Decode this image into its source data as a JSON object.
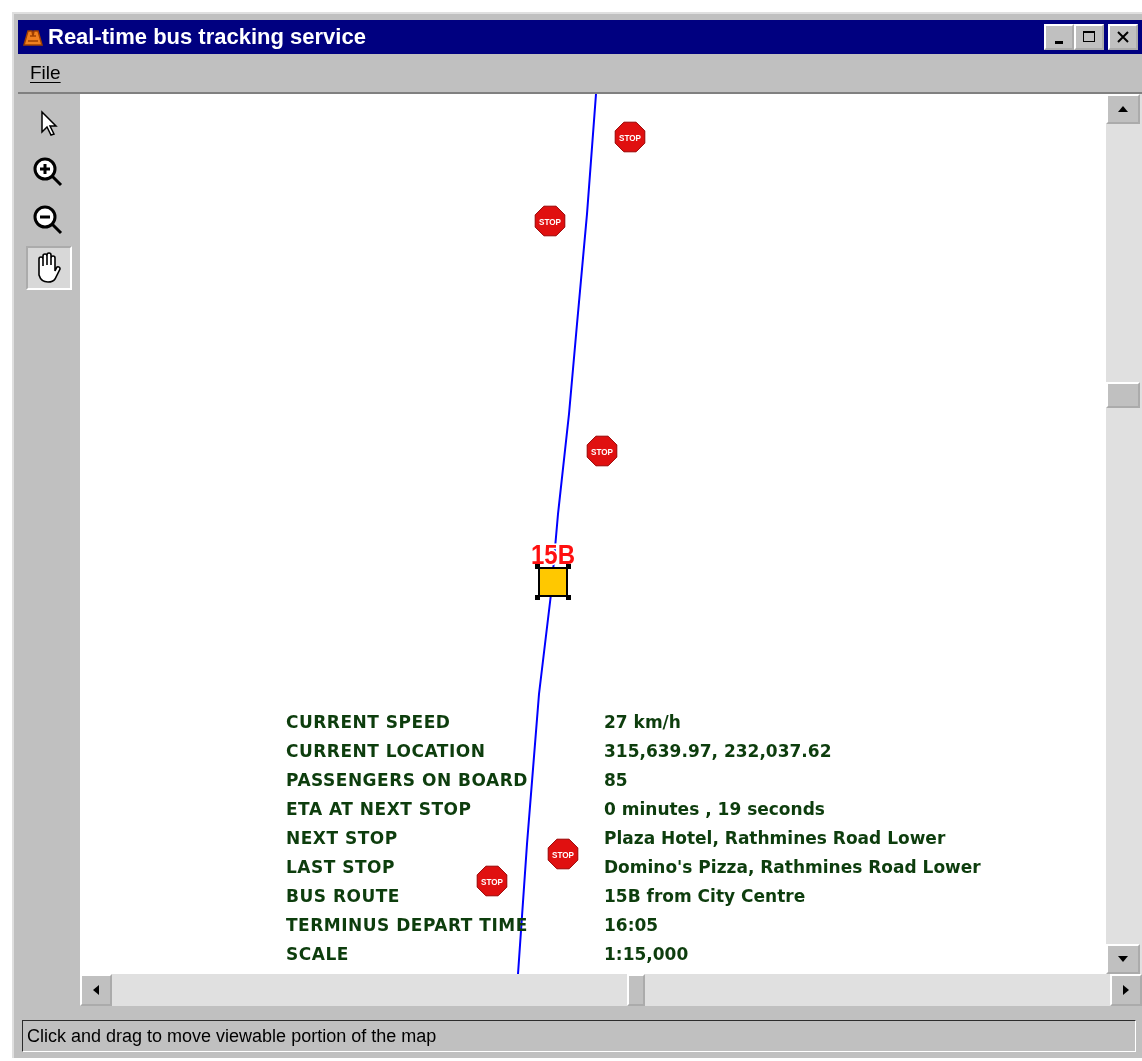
{
  "window": {
    "title": "Real-time bus tracking service"
  },
  "menu": [
    "File"
  ],
  "tools": [
    {
      "kind": "pointer",
      "selected": false
    },
    {
      "kind": "zoom-in",
      "selected": false
    },
    {
      "kind": "zoom-out",
      "selected": false
    },
    {
      "kind": "pan",
      "selected": true
    }
  ],
  "map": {
    "stops": [
      {
        "label": "STOP"
      },
      {
        "label": "STOP"
      },
      {
        "label": "STOP"
      },
      {
        "label": "STOP"
      },
      {
        "label": "STOP"
      }
    ],
    "bus": {
      "route": "15B"
    },
    "info": [
      {
        "label": "CURRENT SPEED",
        "value": "27 km/h"
      },
      {
        "label": "CURRENT LOCATION",
        "value": "315,639.97, 232,037.62"
      },
      {
        "label": "PASSENGERS ON BOARD",
        "value": "85"
      },
      {
        "label": "ETA AT NEXT STOP",
        "value": "0 minutes , 19 seconds"
      },
      {
        "label": "NEXT STOP",
        "value": "Plaza Hotel, Rathmines Road Lower"
      },
      {
        "label": "LAST STOP",
        "value": "Domino's Pizza, Rathmines Road Lower"
      },
      {
        "label": "BUS ROUTE",
        "value": "15B from City Centre"
      },
      {
        "label": "TERMINUS DEPART TIME",
        "value": "16:05"
      },
      {
        "label": "SCALE",
        "value": "1:15,000"
      }
    ]
  },
  "status_bar": "Click and drag to move viewable portion of the map"
}
